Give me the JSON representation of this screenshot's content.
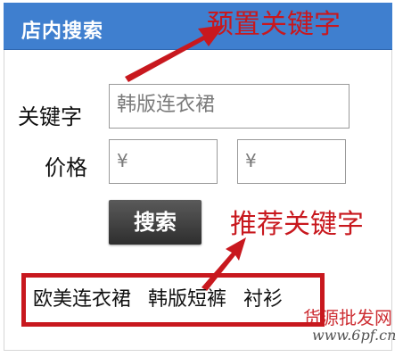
{
  "header": {
    "title": "店内搜索"
  },
  "annotations": {
    "preset_keyword": "预置关键字",
    "recommend_keyword": "推荐关键字"
  },
  "form": {
    "keyword_label": "关键字",
    "keyword_value": "韩版连衣裙",
    "price_label": "价格",
    "price_min_placeholder": "¥",
    "price_max_placeholder": "¥",
    "search_button": "搜索"
  },
  "recommended_tags": [
    "欧美连衣裙",
    "韩版短裤",
    "衬衫"
  ],
  "watermark": {
    "text": "货源批发网",
    "url": "www.6pf.cn"
  },
  "colors": {
    "header_bg": "#3f7fcf",
    "annotation_red": "#c8181e",
    "button_dark": "#3a3a3a"
  }
}
